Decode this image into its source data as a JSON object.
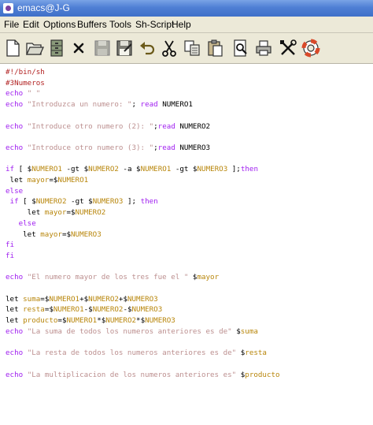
{
  "window": {
    "title": "emacs@J-G"
  },
  "menubar": {
    "items": [
      {
        "label": "File"
      },
      {
        "label": "Edit"
      },
      {
        "label": "Options"
      },
      {
        "label": "Buffers"
      },
      {
        "label": "Tools"
      },
      {
        "label": "Sh-Script"
      },
      {
        "label": "Help"
      }
    ]
  },
  "toolbar": {
    "buttons": [
      {
        "name": "new-file-button",
        "icon": "new-file-icon"
      },
      {
        "name": "open-folder-button",
        "icon": "folder-icon"
      },
      {
        "name": "dired-button",
        "icon": "file-cabinet-icon"
      },
      {
        "name": "close-buffer-button",
        "icon": "close-icon"
      },
      {
        "name": "save-button",
        "icon": "save-disk-icon"
      },
      {
        "name": "save-as-button",
        "icon": "save-as-icon"
      },
      {
        "name": "undo-button",
        "icon": "undo-icon"
      },
      {
        "name": "cut-button",
        "icon": "scissors-icon"
      },
      {
        "name": "copy-button",
        "icon": "copy-icon"
      },
      {
        "name": "paste-button",
        "icon": "paste-icon"
      },
      {
        "name": "search-button",
        "icon": "search-icon"
      },
      {
        "name": "print-button",
        "icon": "printer-icon"
      },
      {
        "name": "customize-button",
        "icon": "tools-icon"
      },
      {
        "name": "help-button",
        "icon": "lifebuoy-icon"
      }
    ]
  },
  "syntax_colors": {
    "comment": "#b22222",
    "keyword": "#a020f0",
    "string": "#bc8f8f",
    "variable": "#b8860b",
    "plain": "#000000"
  },
  "code": {
    "lines": [
      [
        {
          "t": "#!/bin/sh",
          "c": "comment"
        }
      ],
      [
        {
          "t": "#3Numeros",
          "c": "comment"
        }
      ],
      [
        {
          "t": "echo",
          "c": "keyword"
        },
        {
          "t": " ",
          "c": "plain"
        },
        {
          "t": "\" \"",
          "c": "string"
        }
      ],
      [
        {
          "t": "echo",
          "c": "keyword"
        },
        {
          "t": " ",
          "c": "plain"
        },
        {
          "t": "\"Introduzca un numero: \"",
          "c": "string"
        },
        {
          "t": "; ",
          "c": "plain"
        },
        {
          "t": "read",
          "c": "keyword"
        },
        {
          "t": " NUMERO1",
          "c": "plain"
        }
      ],
      [],
      [
        {
          "t": "echo",
          "c": "keyword"
        },
        {
          "t": " ",
          "c": "plain"
        },
        {
          "t": "\"Introduce otro numero (2): \"",
          "c": "string"
        },
        {
          "t": ";",
          "c": "plain"
        },
        {
          "t": "read",
          "c": "keyword"
        },
        {
          "t": " NUMERO2",
          "c": "plain"
        }
      ],
      [],
      [
        {
          "t": "echo",
          "c": "keyword"
        },
        {
          "t": " ",
          "c": "plain"
        },
        {
          "t": "\"Introduce otro numero (3): \"",
          "c": "string"
        },
        {
          "t": ";",
          "c": "plain"
        },
        {
          "t": "read",
          "c": "keyword"
        },
        {
          "t": " NUMERO3",
          "c": "plain"
        }
      ],
      [],
      [
        {
          "t": "if",
          "c": "keyword"
        },
        {
          "t": " [ $",
          "c": "plain"
        },
        {
          "t": "NUMERO1",
          "c": "variable"
        },
        {
          "t": " -gt $",
          "c": "plain"
        },
        {
          "t": "NUMERO2",
          "c": "variable"
        },
        {
          "t": " -a $",
          "c": "plain"
        },
        {
          "t": "NUMERO1",
          "c": "variable"
        },
        {
          "t": " -gt $",
          "c": "plain"
        },
        {
          "t": "NUMERO3",
          "c": "variable"
        },
        {
          "t": " ];",
          "c": "plain"
        },
        {
          "t": "then",
          "c": "keyword"
        }
      ],
      [
        {
          "t": " let ",
          "c": "plain"
        },
        {
          "t": "mayor",
          "c": "variable"
        },
        {
          "t": "=$",
          "c": "plain"
        },
        {
          "t": "NUMERO1",
          "c": "variable"
        }
      ],
      [
        {
          "t": "else",
          "c": "keyword"
        }
      ],
      [
        {
          "t": " ",
          "c": "plain"
        },
        {
          "t": "if",
          "c": "keyword"
        },
        {
          "t": " [ $",
          "c": "plain"
        },
        {
          "t": "NUMERO2",
          "c": "variable"
        },
        {
          "t": " -gt $",
          "c": "plain"
        },
        {
          "t": "NUMERO3",
          "c": "variable"
        },
        {
          "t": " ]; ",
          "c": "plain"
        },
        {
          "t": "then",
          "c": "keyword"
        }
      ],
      [
        {
          "t": "     let ",
          "c": "plain"
        },
        {
          "t": "mayor",
          "c": "variable"
        },
        {
          "t": "=$",
          "c": "plain"
        },
        {
          "t": "NUMERO2",
          "c": "variable"
        }
      ],
      [
        {
          "t": "   ",
          "c": "plain"
        },
        {
          "t": "else",
          "c": "keyword"
        }
      ],
      [
        {
          "t": "    let ",
          "c": "plain"
        },
        {
          "t": "mayor",
          "c": "variable"
        },
        {
          "t": "=$",
          "c": "plain"
        },
        {
          "t": "NUMERO3",
          "c": "variable"
        }
      ],
      [
        {
          "t": "fi",
          "c": "keyword"
        }
      ],
      [
        {
          "t": "fi",
          "c": "keyword"
        }
      ],
      [],
      [
        {
          "t": "echo",
          "c": "keyword"
        },
        {
          "t": " ",
          "c": "plain"
        },
        {
          "t": "\"El numero mayor de los tres fue el \"",
          "c": "string"
        },
        {
          "t": " $",
          "c": "plain"
        },
        {
          "t": "mayor",
          "c": "variable"
        }
      ],
      [],
      [
        {
          "t": "let ",
          "c": "plain"
        },
        {
          "t": "suma",
          "c": "variable"
        },
        {
          "t": "=$",
          "c": "plain"
        },
        {
          "t": "NUMERO1",
          "c": "variable"
        },
        {
          "t": "+$",
          "c": "plain"
        },
        {
          "t": "NUMERO2",
          "c": "variable"
        },
        {
          "t": "+$",
          "c": "plain"
        },
        {
          "t": "NUMERO3",
          "c": "variable"
        }
      ],
      [
        {
          "t": "let ",
          "c": "plain"
        },
        {
          "t": "resta",
          "c": "variable"
        },
        {
          "t": "=$",
          "c": "plain"
        },
        {
          "t": "NUMERO1",
          "c": "variable"
        },
        {
          "t": "-$",
          "c": "plain"
        },
        {
          "t": "NUMERO2",
          "c": "variable"
        },
        {
          "t": "-$",
          "c": "plain"
        },
        {
          "t": "NUMERO3",
          "c": "variable"
        }
      ],
      [
        {
          "t": "let ",
          "c": "plain"
        },
        {
          "t": "producto",
          "c": "variable"
        },
        {
          "t": "=$",
          "c": "plain"
        },
        {
          "t": "NUMERO1",
          "c": "variable"
        },
        {
          "t": "*$",
          "c": "plain"
        },
        {
          "t": "NUMERO2",
          "c": "variable"
        },
        {
          "t": "*$",
          "c": "plain"
        },
        {
          "t": "NUMERO3",
          "c": "variable"
        }
      ],
      [
        {
          "t": "echo",
          "c": "keyword"
        },
        {
          "t": " ",
          "c": "plain"
        },
        {
          "t": "\"La suma de todos los numeros anteriores es de\"",
          "c": "string"
        },
        {
          "t": " $",
          "c": "plain"
        },
        {
          "t": "suma",
          "c": "variable"
        }
      ],
      [],
      [
        {
          "t": "echo",
          "c": "keyword"
        },
        {
          "t": " ",
          "c": "plain"
        },
        {
          "t": "\"La resta de todos los numeros anteriores es de\"",
          "c": "string"
        },
        {
          "t": " $",
          "c": "plain"
        },
        {
          "t": "resta",
          "c": "variable"
        }
      ],
      [],
      [
        {
          "t": "echo",
          "c": "keyword"
        },
        {
          "t": " ",
          "c": "plain"
        },
        {
          "t": "\"La multiplicacion de los numeros anteriores es\"",
          "c": "string"
        },
        {
          "t": " $",
          "c": "plain"
        },
        {
          "t": "producto",
          "c": "variable"
        }
      ]
    ]
  }
}
